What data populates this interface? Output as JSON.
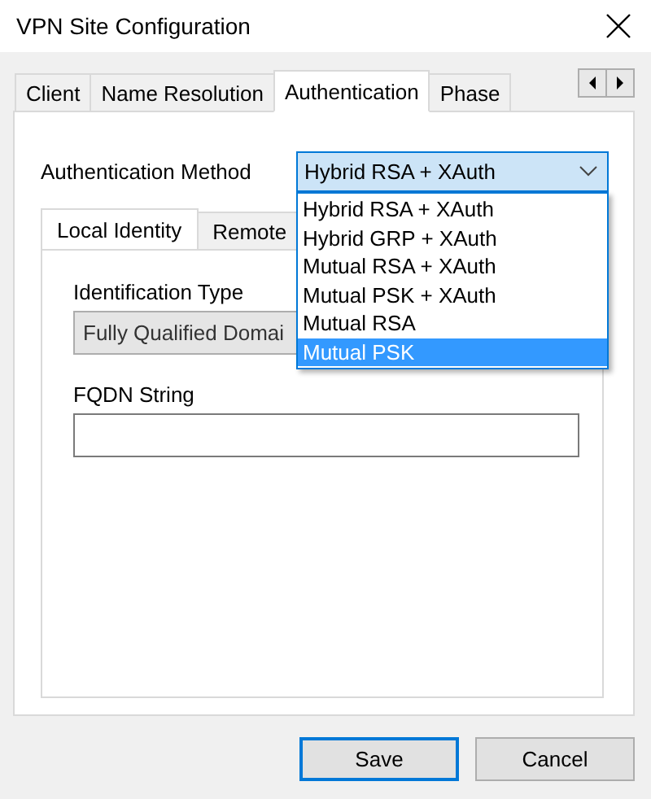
{
  "window": {
    "title": "VPN Site Configuration"
  },
  "tabs": [
    {
      "label": "Client",
      "selected": false
    },
    {
      "label": "Name Resolution",
      "selected": false
    },
    {
      "label": "Authentication",
      "selected": true
    },
    {
      "label": "Phase",
      "selected": false
    }
  ],
  "authentication_method": {
    "label": "Authentication Method",
    "value": "Hybrid RSA + XAuth",
    "expanded": true,
    "options": [
      {
        "label": "Hybrid RSA + XAuth",
        "highlighted": false
      },
      {
        "label": "Hybrid GRP + XAuth",
        "highlighted": false
      },
      {
        "label": "Mutual RSA + XAuth",
        "highlighted": false
      },
      {
        "label": "Mutual PSK + XAuth",
        "highlighted": false
      },
      {
        "label": "Mutual RSA",
        "highlighted": false
      },
      {
        "label": "Mutual PSK",
        "highlighted": true
      }
    ]
  },
  "identity_tabs": [
    {
      "label": "Local Identity",
      "selected": true
    },
    {
      "label": "Remote",
      "selected": false
    }
  ],
  "identification_type": {
    "label": "Identification Type",
    "value": "Fully Qualified Domai",
    "disabled": true
  },
  "fqdn_string": {
    "label": "FQDN String"
  },
  "buttons": [
    {
      "label": "Save",
      "default": true
    },
    {
      "label": "Cancel",
      "default": false
    }
  ]
}
